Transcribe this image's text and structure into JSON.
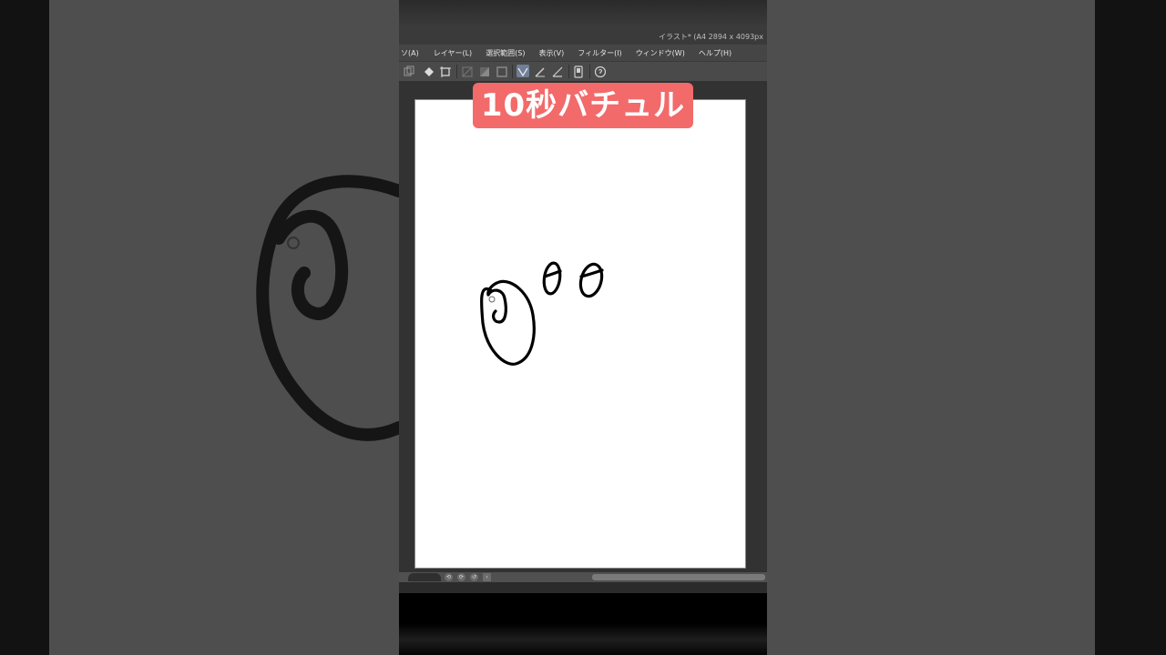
{
  "caption": "10秒バチュル",
  "window": {
    "title": "イラスト* (A4 2894 x 4093px"
  },
  "menu": [
    {
      "label": "ソ(A)"
    },
    {
      "label": "レイヤー(L)"
    },
    {
      "label": "選択範囲(S)"
    },
    {
      "label": "表示(V)"
    },
    {
      "label": "フィルター(I)"
    },
    {
      "label": "ウィンドウ(W)"
    },
    {
      "label": "ヘルプ(H)"
    }
  ],
  "toolbar": {
    "icons": [
      "copy-icon",
      "fill-icon",
      "transform-icon",
      "clear-icon",
      "gradient-icon",
      "frame-icon",
      "pen-tool-icon",
      "pencil-tool-icon",
      "ruler-icon",
      "phone-icon",
      "help-icon"
    ],
    "active": "pen-tool-icon"
  },
  "colors": {
    "caption_bg": "#f26a6a",
    "canvas": "#ffffff",
    "workarea": "#323232",
    "menubar": "#454545"
  }
}
